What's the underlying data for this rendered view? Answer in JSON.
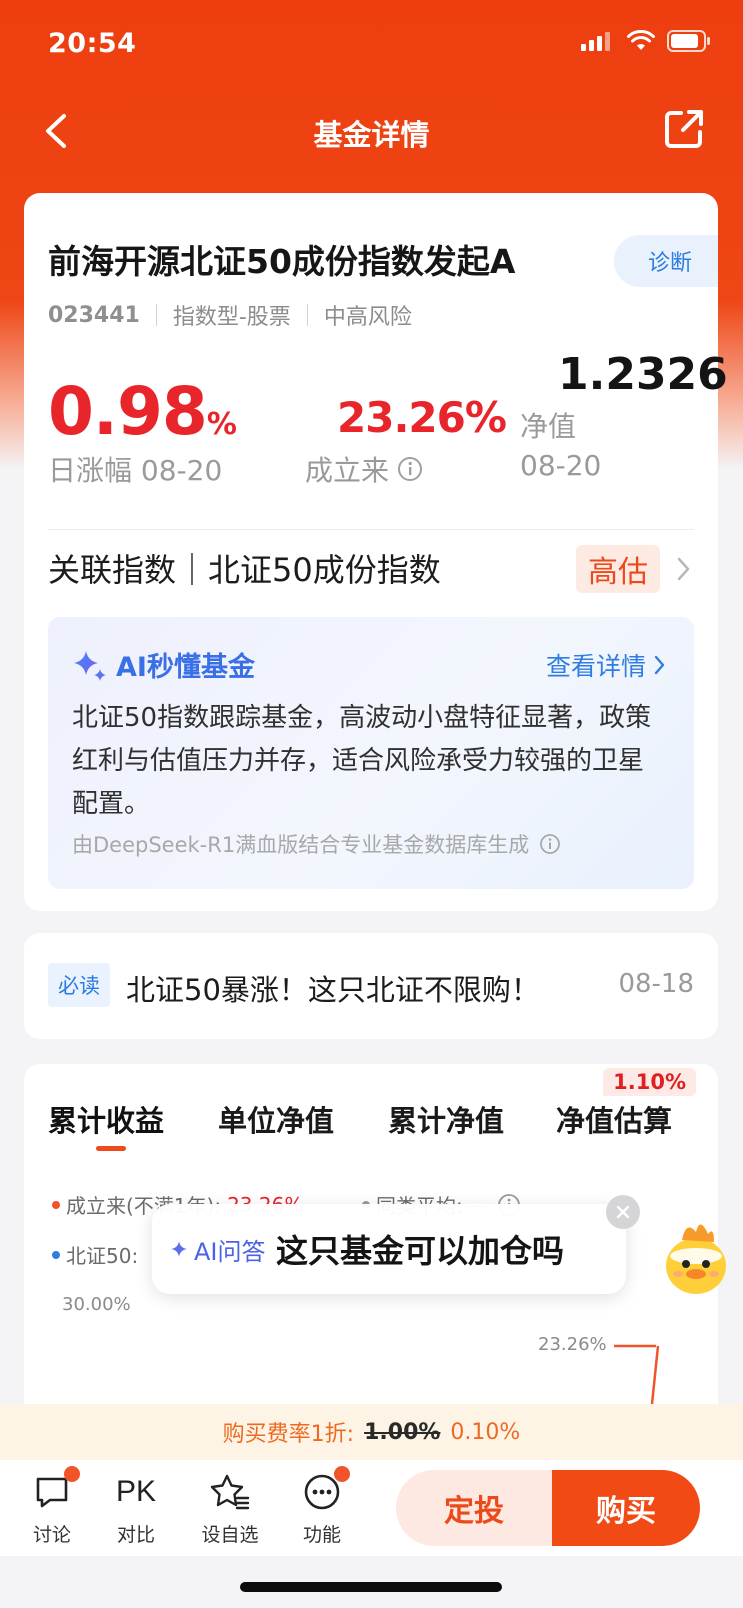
{
  "status_bar": {
    "time": "20:54"
  },
  "nav": {
    "title": "基金详情"
  },
  "fund": {
    "name": "前海开源北证50成份指数发起A",
    "diagnose_label": "诊断",
    "code": "023441",
    "type": "指数型-股票",
    "risk": "中高风险",
    "daily_change_value": "0.98",
    "daily_change_unit": "%",
    "daily_change_label": "日涨幅 08-20",
    "since_inception_value": "23.26%",
    "since_inception_label": "成立来",
    "nav_value": "1.2326",
    "nav_label": "净值",
    "nav_date": "08-20"
  },
  "related_index": {
    "text": "关联指数｜北证50成份指数",
    "valuation_badge": "高估"
  },
  "ai_summary": {
    "title": "AI秒懂基金",
    "detail_link": "查看详情",
    "body": "北证50指数跟踪基金，高波动小盘特征显著，政策红利与估值压力并存，适合风险承受力较强的卫星配置。",
    "footnote": "由DeepSeek-R1满血版结合专业基金数据库生成"
  },
  "news": {
    "badge": "必读",
    "title": "北证50暴涨！这只北证不限购！",
    "date": "08-18"
  },
  "chart_section": {
    "tabs": [
      "累计收益",
      "单位净值",
      "累计净值",
      "净值估算"
    ],
    "estimate_badge": "1.10%",
    "legend_fund_label": "成立来(不满1年):",
    "legend_fund_value": "23.26%",
    "legend_avg_label": "同类平均:",
    "legend_avg_value": "--",
    "legend_index_label": "北证50:",
    "axis_top": "30.00%",
    "end_value_label": "23.26%"
  },
  "ai_popup": {
    "label": "AI问答",
    "question": "这只基金可以加仓吗"
  },
  "fee_bar": {
    "prefix": "购买费率1折:",
    "old_rate": "1.00%",
    "new_rate": "0.10%"
  },
  "bottom_bar": {
    "items": [
      {
        "label": "讨论",
        "icon": "chat-bubble-icon"
      },
      {
        "label": "对比",
        "icon": "pk-icon",
        "icon_text": "PK"
      },
      {
        "label": "设自选",
        "icon": "star-list-icon"
      },
      {
        "label": "功能",
        "icon": "more-dots-icon"
      }
    ],
    "dingtou_label": "定投",
    "buy_label": "购买"
  },
  "colors": {
    "brand_orange": "#ee4614",
    "rise_red": "#e8252b",
    "link_blue": "#2f7de0"
  }
}
